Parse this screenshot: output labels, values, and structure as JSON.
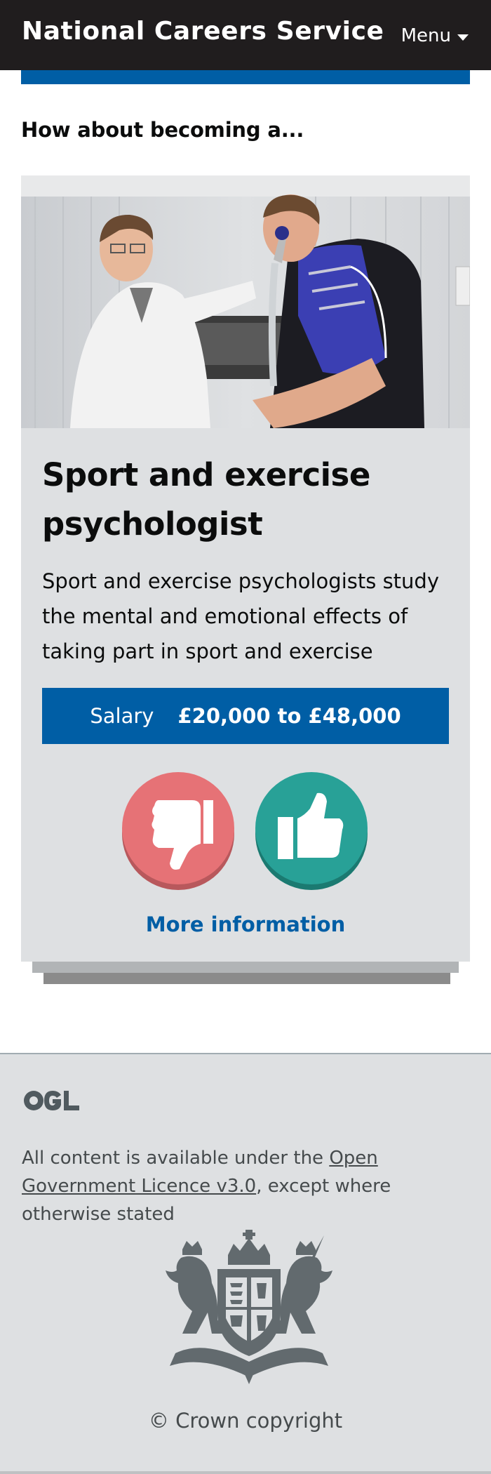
{
  "header": {
    "brand": "National Careers Service",
    "menu_label": "Menu"
  },
  "prompt": "How about becoming a...",
  "card": {
    "title": "Sport and exercise psychologist",
    "description": "Sport and exercise psychologists study the mental and emotional effects of taking part in sport and exercise",
    "salary_label": "Salary",
    "salary_value": "£20,000 to £48,000",
    "more_info": "More information",
    "dislike_color": "#e67276",
    "like_color": "#28a197",
    "accent_color": "#005ea5"
  },
  "footer": {
    "licence_prefix": "All content is available under the ",
    "licence_link": "Open Government Licence v3.0",
    "licence_suffix": ", except where otherwise stated",
    "copyright": "© Crown copyright"
  },
  "icons": {
    "dislike": "thumbs-down-icon",
    "like": "thumbs-up-icon",
    "menu": "chevron-down-icon",
    "licence_logo": "ogl-logo-icon",
    "crest": "royal-coat-of-arms-icon"
  }
}
